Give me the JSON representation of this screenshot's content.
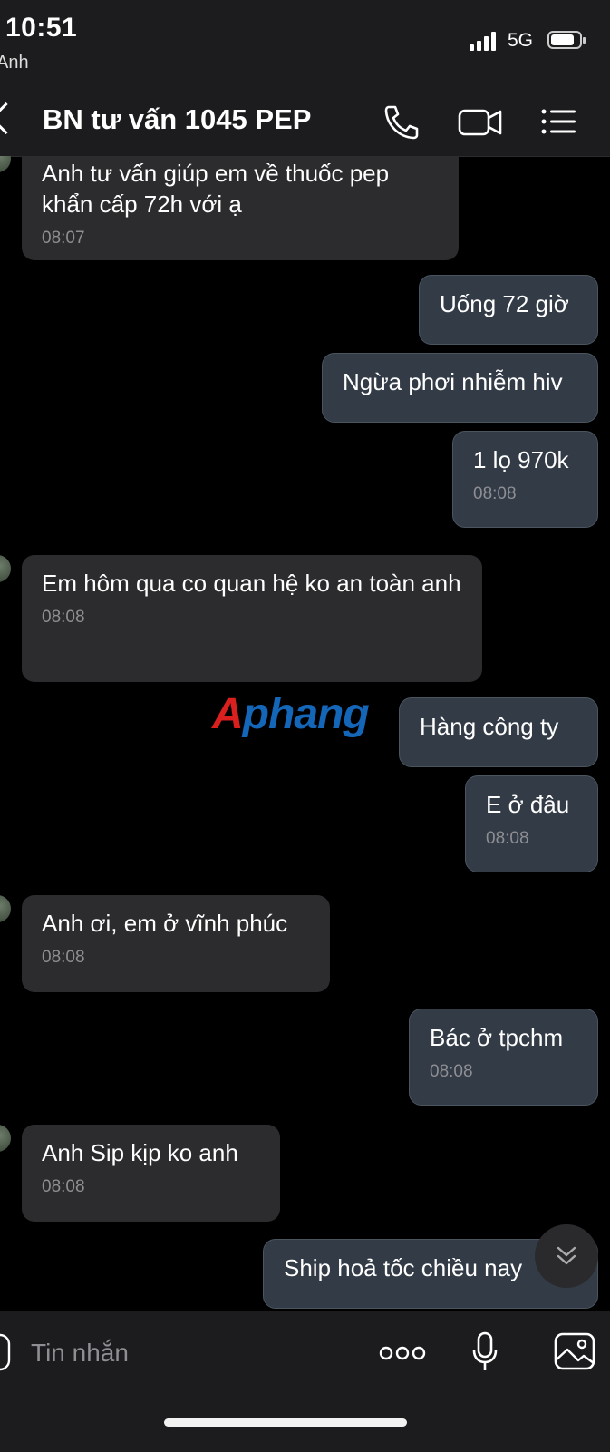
{
  "status_bar": {
    "time": "10:51",
    "carrier": "Anh",
    "network": "5G",
    "signal_bars": 4,
    "battery_level": 0.75
  },
  "header": {
    "title": "BN tư vấn 1045 PEP",
    "back_icon": "chevron-left-icon",
    "call_icon": "phone-icon",
    "video_icon": "video-camera-icon",
    "menu_icon": "list-menu-icon"
  },
  "messages": [
    {
      "direction": "incoming",
      "text": "Anh tư vấn giúp em về thuốc pep khẩn cấp 72h với ạ",
      "time": "08:07"
    },
    {
      "direction": "outgoing",
      "text": "Uống 72 giờ",
      "time": ""
    },
    {
      "direction": "outgoing",
      "text": "Ngừa phơi nhiễm hiv",
      "time": ""
    },
    {
      "direction": "outgoing",
      "text": "1 lọ 970k",
      "time": "08:08"
    },
    {
      "direction": "incoming",
      "text": "Em hôm qua co quan hệ ko an toàn anh",
      "time": "08:08"
    },
    {
      "direction": "outgoing",
      "text": "Hàng công ty",
      "time": ""
    },
    {
      "direction": "outgoing",
      "text": "E ở đâu",
      "time": "08:08"
    },
    {
      "direction": "incoming",
      "text": "Anh ơi, em ở vĩnh phúc",
      "time": "08:08"
    },
    {
      "direction": "outgoing",
      "text": "Bác ở tpchm",
      "time": "08:08"
    },
    {
      "direction": "incoming",
      "text": "Anh Sip kịp ko anh",
      "time": "08:08"
    },
    {
      "direction": "outgoing",
      "text": "Ship hoả tốc chiều nay",
      "time": ""
    }
  ],
  "watermark": {
    "first": "A",
    "rest": "phang"
  },
  "input": {
    "placeholder": "Tin nhắn",
    "more_icon": "more-dots-icon",
    "mic_icon": "microphone-icon",
    "image_icon": "image-icon"
  },
  "scroll_down_icon": "chevron-double-down-icon",
  "colors": {
    "background": "#000000",
    "incoming_bubble": "#2c2c2e",
    "outgoing_bubble": "#323b46",
    "timestamp": "#8e8e93",
    "watermark_red": "#d9201e",
    "watermark_blue": "#1466b8"
  }
}
